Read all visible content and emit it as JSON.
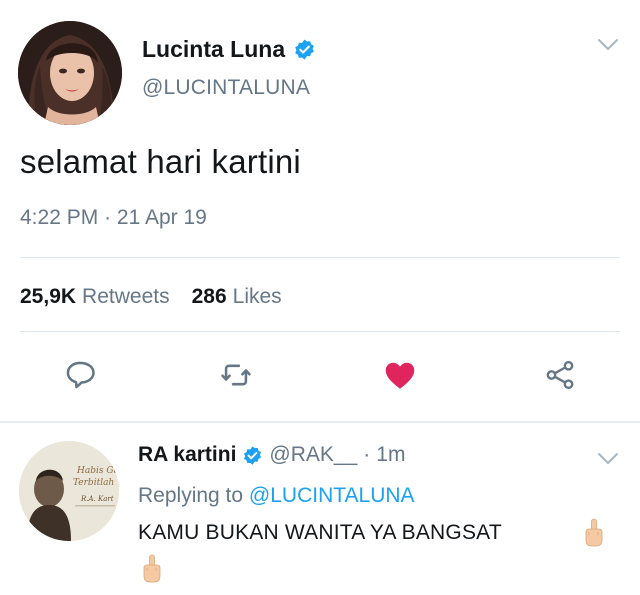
{
  "main_tweet": {
    "display_name": "Lucinta Luna",
    "handle": "@LUCINTALUNA",
    "text": "selamat hari kartini",
    "time": "4:22 PM",
    "separator": "·",
    "date": "21 Apr 19",
    "retweets_count": "25,9K",
    "retweets_label": "Retweets",
    "likes_count": "286",
    "likes_label": "Likes",
    "liked": true
  },
  "reply": {
    "display_name": "RA kartini",
    "handle": "@RAK__",
    "separator": "·",
    "time_ago": "1m",
    "replying_prefix": "Replying to",
    "replying_handle": "@LUCINTALUNA",
    "text": "KAMU BUKAN WANITA YA BANGSAT",
    "avatar_text_1": "Habis Ge",
    "avatar_text_2": "Terbitlah Te",
    "avatar_text_3": "R.A. Kart"
  },
  "icons": {
    "verified": "verified-badge-icon",
    "reply": "reply-icon",
    "retweet": "retweet-icon",
    "like": "heart-icon",
    "share": "share-icon",
    "menu": "chevron-down-icon"
  },
  "colors": {
    "accent": "#1da1f2",
    "like": "#e0245e",
    "text": "#14171a",
    "muted": "#657786"
  }
}
